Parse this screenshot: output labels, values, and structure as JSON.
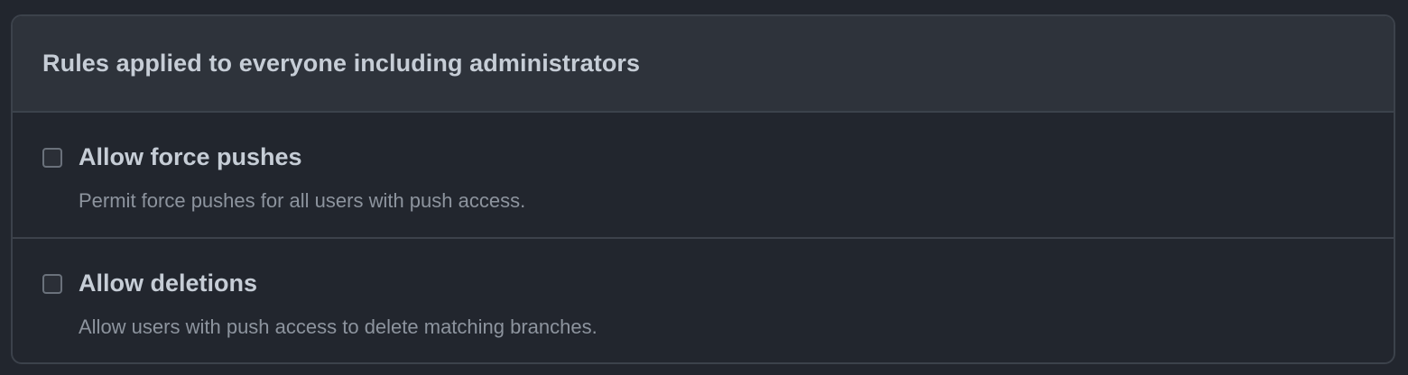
{
  "panel": {
    "title": "Rules applied to everyone including administrators"
  },
  "rules": [
    {
      "label": "Allow force pushes",
      "description": "Permit force pushes for all users with push access.",
      "checked": false
    },
    {
      "label": "Allow deletions",
      "description": "Allow users with push access to delete matching branches.",
      "checked": false
    }
  ],
  "colors": {
    "background": "#22262e",
    "header_background": "#2e333b",
    "border": "#3c424b",
    "text_primary": "#c6cdd6",
    "text_secondary": "#8d949e"
  }
}
